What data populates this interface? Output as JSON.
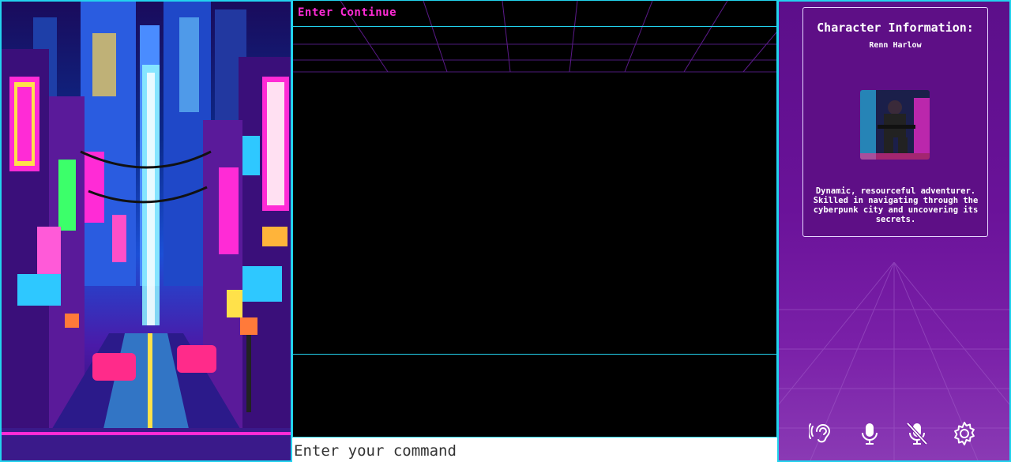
{
  "log": {
    "title": "Enter Continue"
  },
  "command": {
    "placeholder": "Enter your command"
  },
  "character": {
    "heading": "Character Information:",
    "name": "Renn Harlow",
    "description": "Dynamic, resourceful adventurer. Skilled in navigating through the cyberpunk city and uncovering its secrets."
  },
  "toolbar": {
    "icons": [
      "ear-icon",
      "microphone-icon",
      "microphone-off-icon",
      "gear-icon"
    ]
  },
  "colors": {
    "accent_cyan": "#22d3ee",
    "title_magenta": "#ff2bd6",
    "panel_purple": "#6a1299"
  }
}
